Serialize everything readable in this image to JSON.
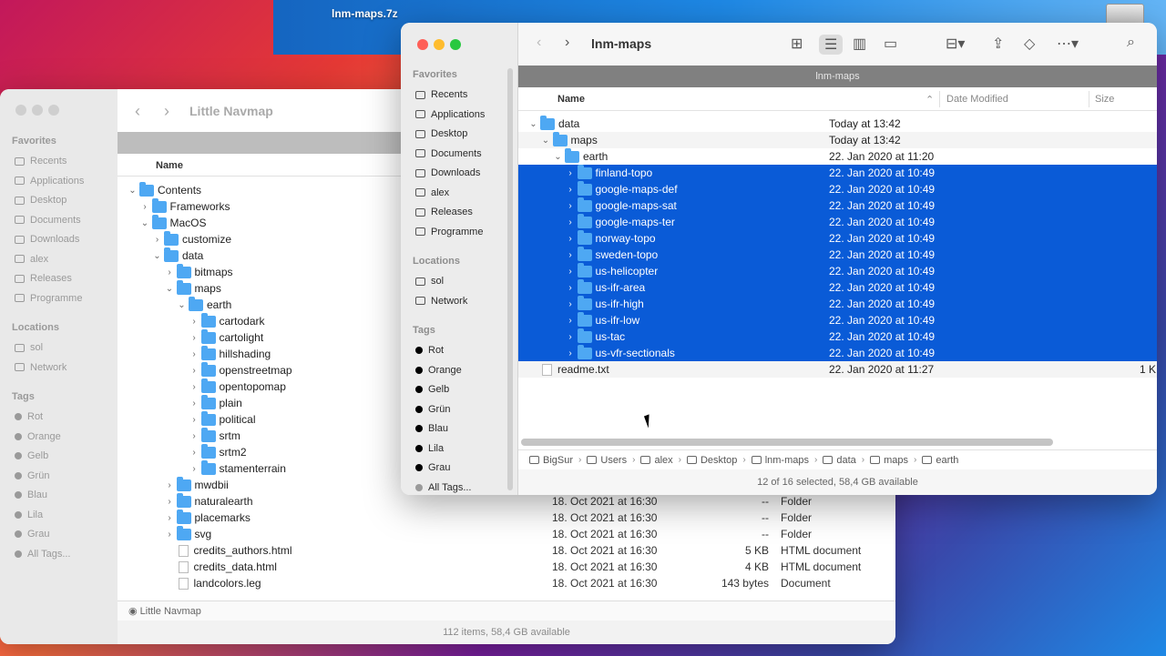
{
  "desktop": {
    "file": "lnm-maps.7z"
  },
  "back": {
    "title": "Little Navmap",
    "sidebar": {
      "favorites": "Favorites",
      "fav_items": [
        "Recents",
        "Applications",
        "Desktop",
        "Documents",
        "Downloads",
        "alex",
        "Releases",
        "Programme"
      ],
      "locations": "Locations",
      "loc_items": [
        "sol",
        "Network"
      ],
      "tags": "Tags",
      "tag_items": [
        "Rot",
        "Orange",
        "Gelb",
        "Grün",
        "Blau",
        "Lila",
        "Grau",
        "All Tags..."
      ]
    },
    "col_name": "Name",
    "rows": [
      {
        "name": "Contents",
        "type": "folder",
        "indent": 0,
        "open": true
      },
      {
        "name": "Frameworks",
        "type": "folder",
        "indent": 1,
        "open": false
      },
      {
        "name": "MacOS",
        "type": "folder",
        "indent": 1,
        "open": true
      },
      {
        "name": "customize",
        "type": "folder",
        "indent": 2,
        "open": false
      },
      {
        "name": "data",
        "type": "folder",
        "indent": 2,
        "open": true
      },
      {
        "name": "bitmaps",
        "type": "folder",
        "indent": 3,
        "open": false
      },
      {
        "name": "maps",
        "type": "folder",
        "indent": 3,
        "open": true
      },
      {
        "name": "earth",
        "type": "folder",
        "indent": 4,
        "open": true
      },
      {
        "name": "cartodark",
        "type": "folder",
        "indent": 5,
        "open": false
      },
      {
        "name": "cartolight",
        "type": "folder",
        "indent": 5,
        "open": false
      },
      {
        "name": "hillshading",
        "type": "folder",
        "indent": 5,
        "open": false
      },
      {
        "name": "openstreetmap",
        "type": "folder",
        "indent": 5,
        "open": false
      },
      {
        "name": "opentopomap",
        "type": "folder",
        "indent": 5,
        "open": false
      },
      {
        "name": "plain",
        "type": "folder",
        "indent": 5,
        "open": false
      },
      {
        "name": "political",
        "type": "folder",
        "indent": 5,
        "open": false
      },
      {
        "name": "srtm",
        "type": "folder",
        "indent": 5,
        "open": false
      },
      {
        "name": "srtm2",
        "type": "folder",
        "indent": 5,
        "open": false
      },
      {
        "name": "stamenterrain",
        "type": "folder",
        "indent": 5,
        "open": false
      },
      {
        "name": "mwdbii",
        "type": "folder",
        "indent": 3,
        "open": false,
        "date": "18. Oct 2021 at 16:30",
        "size": "--",
        "kind": "Folder"
      },
      {
        "name": "naturalearth",
        "type": "folder",
        "indent": 3,
        "open": false,
        "date": "18. Oct 2021 at 16:30",
        "size": "--",
        "kind": "Folder"
      },
      {
        "name": "placemarks",
        "type": "folder",
        "indent": 3,
        "open": false,
        "date": "18. Oct 2021 at 16:30",
        "size": "--",
        "kind": "Folder"
      },
      {
        "name": "svg",
        "type": "folder",
        "indent": 3,
        "open": false,
        "date": "18. Oct 2021 at 16:30",
        "size": "--",
        "kind": "Folder"
      },
      {
        "name": "credits_authors.html",
        "type": "file",
        "indent": 3,
        "date": "18. Oct 2021 at 16:30",
        "size": "5 KB",
        "kind": "HTML document"
      },
      {
        "name": "credits_data.html",
        "type": "file",
        "indent": 3,
        "date": "18. Oct 2021 at 16:30",
        "size": "4 KB",
        "kind": "HTML document"
      },
      {
        "name": "landcolors.leg",
        "type": "file",
        "indent": 3,
        "date": "18. Oct 2021 at 16:30",
        "size": "143 bytes",
        "kind": "Document"
      }
    ],
    "path": "Little Navmap",
    "status": "112 items, 58,4 GB available"
  },
  "front": {
    "title": "lnm-maps",
    "tab": "lnm-maps",
    "sidebar": {
      "favorites": "Favorites",
      "fav_items": [
        "Recents",
        "Applications",
        "Desktop",
        "Documents",
        "Downloads",
        "alex",
        "Releases",
        "Programme"
      ],
      "locations": "Locations",
      "loc_items": [
        "sol",
        "Network"
      ],
      "tags": "Tags",
      "tag_items": [
        "Rot",
        "Orange",
        "Gelb",
        "Grün",
        "Blau",
        "Lila",
        "Grau",
        "All Tags..."
      ]
    },
    "columns": {
      "name": "Name",
      "date": "Date Modified",
      "size": "Size"
    },
    "rows": [
      {
        "name": "data",
        "type": "folder",
        "indent": 0,
        "open": true,
        "date": "Today at 13:42",
        "sel": false
      },
      {
        "name": "maps",
        "type": "folder",
        "indent": 1,
        "open": true,
        "date": "Today at 13:42",
        "sel": false
      },
      {
        "name": "earth",
        "type": "folder",
        "indent": 2,
        "open": true,
        "date": "22. Jan 2020 at 11:20",
        "sel": false
      },
      {
        "name": "finland-topo",
        "type": "folder",
        "indent": 3,
        "open": false,
        "date": "22. Jan 2020 at 10:49",
        "sel": true
      },
      {
        "name": "google-maps-def",
        "type": "folder",
        "indent": 3,
        "open": false,
        "date": "22. Jan 2020 at 10:49",
        "sel": true
      },
      {
        "name": "google-maps-sat",
        "type": "folder",
        "indent": 3,
        "open": false,
        "date": "22. Jan 2020 at 10:49",
        "sel": true
      },
      {
        "name": "google-maps-ter",
        "type": "folder",
        "indent": 3,
        "open": false,
        "date": "22. Jan 2020 at 10:49",
        "sel": true
      },
      {
        "name": "norway-topo",
        "type": "folder",
        "indent": 3,
        "open": false,
        "date": "22. Jan 2020 at 10:49",
        "sel": true
      },
      {
        "name": "sweden-topo",
        "type": "folder",
        "indent": 3,
        "open": false,
        "date": "22. Jan 2020 at 10:49",
        "sel": true
      },
      {
        "name": "us-helicopter",
        "type": "folder",
        "indent": 3,
        "open": false,
        "date": "22. Jan 2020 at 10:49",
        "sel": true
      },
      {
        "name": "us-ifr-area",
        "type": "folder",
        "indent": 3,
        "open": false,
        "date": "22. Jan 2020 at 10:49",
        "sel": true
      },
      {
        "name": "us-ifr-high",
        "type": "folder",
        "indent": 3,
        "open": false,
        "date": "22. Jan 2020 at 10:49",
        "sel": true
      },
      {
        "name": "us-ifr-low",
        "type": "folder",
        "indent": 3,
        "open": false,
        "date": "22. Jan 2020 at 10:49",
        "sel": true
      },
      {
        "name": "us-tac",
        "type": "folder",
        "indent": 3,
        "open": false,
        "date": "22. Jan 2020 at 10:49",
        "sel": true
      },
      {
        "name": "us-vfr-sectionals",
        "type": "folder",
        "indent": 3,
        "open": false,
        "date": "22. Jan 2020 at 10:49",
        "sel": true
      },
      {
        "name": "readme.txt",
        "type": "file",
        "indent": 0,
        "date": "22. Jan 2020 at 11:27",
        "sel": false,
        "size": "1 K"
      }
    ],
    "path": [
      "BigSur",
      "Users",
      "alex",
      "Desktop",
      "lnm-maps",
      "data",
      "maps",
      "earth"
    ],
    "status": "12 of 16 selected, 58,4 GB available"
  }
}
